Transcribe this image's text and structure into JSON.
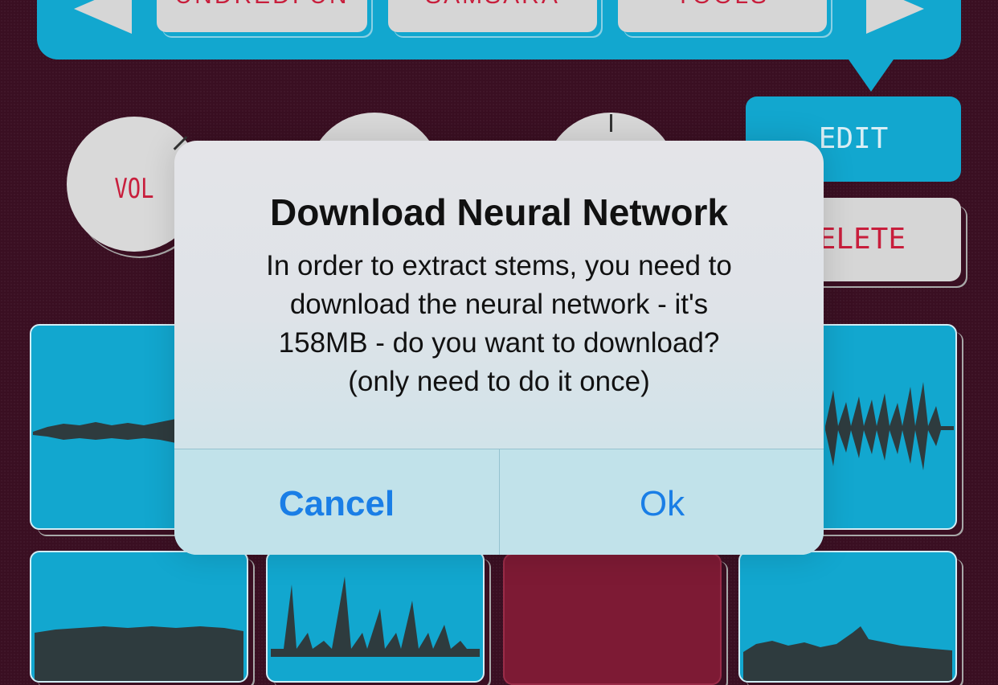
{
  "top_bar": {
    "buttons": [
      {
        "label": "UNDREDFUN"
      },
      {
        "label": "SAMSARA"
      },
      {
        "label": "TOOLS"
      }
    ]
  },
  "knobs": [
    {
      "label": "VOL"
    },
    {
      "label": ""
    },
    {
      "label": ""
    }
  ],
  "side_buttons": {
    "edit_label": "EDIT",
    "delete_label": "DELETE"
  },
  "pads": {
    "colors": {
      "active": "#12a7cf",
      "empty": "#7d1a34",
      "waveform": "#2e3b3e"
    }
  },
  "dialog": {
    "title": "Download Neural Network",
    "message": "In order to extract stems, you need to\ndownload the neural network - it's\n158MB - do you want to download?\n(only need to do it once)",
    "cancel_label": "Cancel",
    "ok_label": "Ok"
  },
  "colors": {
    "background": "#3a0f22",
    "accent": "#12a7cf",
    "label_red": "#c81e3c",
    "ios_blue": "#1a7ee6"
  }
}
